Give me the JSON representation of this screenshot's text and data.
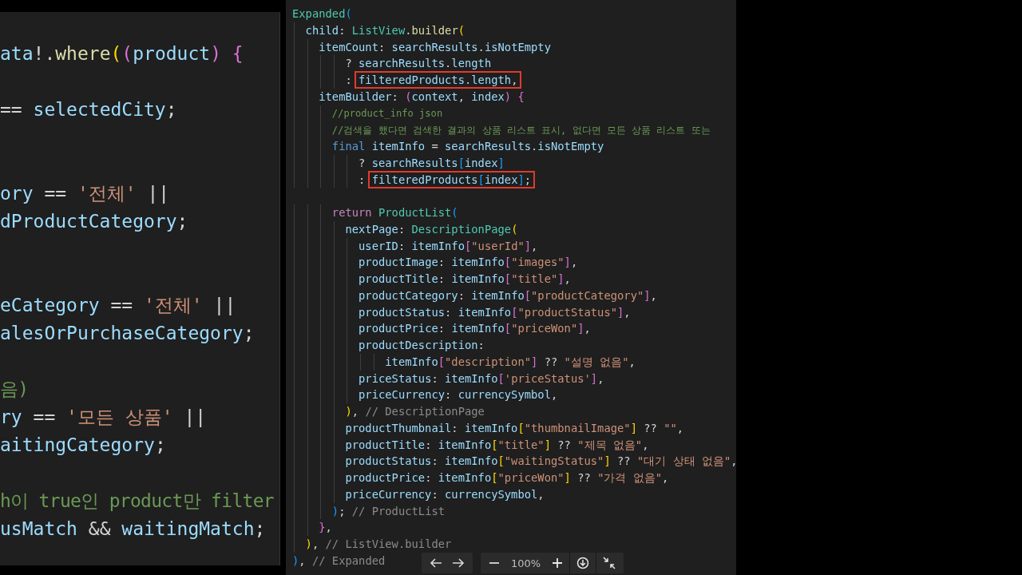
{
  "left_editor": {
    "blocks": [
      {
        "lines": [
          {
            "tokens": [
              {
                "kind": "v",
                "text": "ata"
              },
              {
                "kind": "p",
                "text": "!."
              },
              {
                "kind": "f",
                "text": "where"
              },
              {
                "kind": "b1",
                "text": "("
              },
              {
                "kind": "b2",
                "text": "("
              },
              {
                "kind": "v",
                "text": "product"
              },
              {
                "kind": "b2",
                "text": ") {"
              }
            ]
          }
        ]
      },
      {
        "lines": [
          {
            "tokens": [
              {
                "kind": "p",
                "text": "== "
              },
              {
                "kind": "v",
                "text": "selectedCity"
              },
              {
                "kind": "p",
                "text": ";"
              }
            ]
          }
        ]
      },
      {
        "lines": [
          {
            "tokens": [
              {
                "kind": "v",
                "text": "ory"
              },
              {
                "kind": "p",
                "text": " == "
              },
              {
                "kind": "s",
                "text": "'전체'"
              },
              {
                "kind": "p",
                "text": " ||"
              }
            ]
          },
          {
            "tokens": [
              {
                "kind": "v",
                "text": "dProductCategory"
              },
              {
                "kind": "p",
                "text": ";"
              }
            ]
          }
        ]
      },
      {
        "lines": [
          {
            "tokens": [
              {
                "kind": "v",
                "text": "eCategory"
              },
              {
                "kind": "p",
                "text": " == "
              },
              {
                "kind": "s",
                "text": "'전체'"
              },
              {
                "kind": "p",
                "text": " ||"
              }
            ]
          },
          {
            "tokens": [
              {
                "kind": "v",
                "text": "alesOrPurchaseCategory"
              },
              {
                "kind": "p",
                "text": ";"
              }
            ]
          }
        ]
      },
      {
        "lines": [
          {
            "tokens": [
              {
                "kind": "c",
                "text": "음)"
              }
            ]
          },
          {
            "tokens": [
              {
                "kind": "v",
                "text": "ry"
              },
              {
                "kind": "p",
                "text": " == "
              },
              {
                "kind": "s",
                "text": "'모든 상품'"
              },
              {
                "kind": "p",
                "text": " ||"
              }
            ]
          },
          {
            "tokens": [
              {
                "kind": "v",
                "text": "aitingCategory"
              },
              {
                "kind": "p",
                "text": ";"
              }
            ]
          }
        ]
      },
      {
        "lines": [
          {
            "tokens": [
              {
                "kind": "c",
                "text": "h이 true인 product만 filter"
              }
            ]
          },
          {
            "tokens": [
              {
                "kind": "v",
                "text": "usMatch"
              },
              {
                "kind": "p",
                "text": " && "
              },
              {
                "kind": "v",
                "text": "waitingMatch"
              },
              {
                "kind": "p",
                "text": ";"
              }
            ]
          }
        ]
      }
    ]
  },
  "right_editor": {
    "blocks": [
      {
        "lines": [
          {
            "tokens": [
              {
                "kind": "t",
                "text": "Expanded"
              },
              {
                "kind": "b3",
                "text": "("
              }
            ]
          },
          {
            "tokens": [
              {
                "kind": "v",
                "text": "  child"
              },
              {
                "kind": "p",
                "text": ": "
              },
              {
                "kind": "t",
                "text": "ListView"
              },
              {
                "kind": "p",
                "text": "."
              },
              {
                "kind": "f",
                "text": "builder"
              },
              {
                "kind": "b1",
                "text": "("
              }
            ]
          },
          {
            "tokens": [
              {
                "kind": "v",
                "text": "    itemCount"
              },
              {
                "kind": "p",
                "text": ": "
              },
              {
                "kind": "v",
                "text": "searchResults"
              },
              {
                "kind": "p",
                "text": "."
              },
              {
                "kind": "v",
                "text": "isNotEmpty"
              }
            ]
          },
          {
            "tokens": [
              {
                "kind": "p",
                "text": "        ? "
              },
              {
                "kind": "v",
                "text": "searchResults"
              },
              {
                "kind": "p",
                "text": "."
              },
              {
                "kind": "v",
                "text": "length"
              }
            ]
          },
          {
            "tokens": [
              {
                "kind": "p",
                "text": "        : "
              },
              {
                "kind": "box",
                "tokens": [
                  {
                    "kind": "v",
                    "text": "filteredProducts.length"
                  },
                  {
                    "kind": "p",
                    "text": ","
                  }
                ]
              }
            ]
          },
          {
            "tokens": [
              {
                "kind": "v",
                "text": "    itemBuilder"
              },
              {
                "kind": "p",
                "text": ": "
              },
              {
                "kind": "b2",
                "text": "("
              },
              {
                "kind": "v",
                "text": "context"
              },
              {
                "kind": "p",
                "text": ", "
              },
              {
                "kind": "v",
                "text": "index"
              },
              {
                "kind": "b2",
                "text": ") {"
              }
            ]
          },
          {
            "tokens": [
              {
                "kind": "c",
                "text": "      //product_info json"
              }
            ]
          },
          {
            "tokens": [
              {
                "kind": "c",
                "text": "      //검색을 했다면 검색한 결과의 상품 리스트 표시, 없다면 모든 상품 리스트 또는"
              }
            ]
          },
          {
            "tokens": [
              {
                "kind": "k",
                "text": "      final"
              },
              {
                "kind": "v",
                "text": " itemInfo"
              },
              {
                "kind": "p",
                "text": " = "
              },
              {
                "kind": "v",
                "text": "searchResults"
              },
              {
                "kind": "p",
                "text": "."
              },
              {
                "kind": "v",
                "text": "isNotEmpty"
              }
            ]
          },
          {
            "tokens": [
              {
                "kind": "p",
                "text": "          ? "
              },
              {
                "kind": "v",
                "text": "searchResults"
              },
              {
                "kind": "b3",
                "text": "["
              },
              {
                "kind": "v",
                "text": "index"
              },
              {
                "kind": "b3",
                "text": "]"
              }
            ]
          },
          {
            "tokens": [
              {
                "kind": "p",
                "text": "          : "
              },
              {
                "kind": "box",
                "tokens": [
                  {
                    "kind": "v",
                    "text": "filteredProducts"
                  },
                  {
                    "kind": "b3",
                    "text": "["
                  },
                  {
                    "kind": "v",
                    "text": "index"
                  },
                  {
                    "kind": "b3",
                    "text": "]"
                  },
                  {
                    "kind": "p",
                    "text": ";"
                  }
                ]
              }
            ]
          }
        ]
      },
      {
        "lines": [
          {
            "tokens": [
              {
                "kind": "r",
                "text": "      return "
              },
              {
                "kind": "t",
                "text": "ProductList"
              },
              {
                "kind": "b3",
                "text": "("
              }
            ]
          },
          {
            "tokens": [
              {
                "kind": "v",
                "text": "        nextPage"
              },
              {
                "kind": "p",
                "text": ": "
              },
              {
                "kind": "t",
                "text": "DescriptionPage"
              },
              {
                "kind": "b1",
                "text": "("
              }
            ]
          },
          {
            "tokens": [
              {
                "kind": "v",
                "text": "          userID"
              },
              {
                "kind": "p",
                "text": ": "
              },
              {
                "kind": "v",
                "text": "itemInfo"
              },
              {
                "kind": "b2",
                "text": "["
              },
              {
                "kind": "s",
                "text": "\"userId\""
              },
              {
                "kind": "b2",
                "text": "]"
              },
              {
                "kind": "p",
                "text": ","
              }
            ]
          },
          {
            "tokens": [
              {
                "kind": "v",
                "text": "          productImage"
              },
              {
                "kind": "p",
                "text": ": "
              },
              {
                "kind": "v",
                "text": "itemInfo"
              },
              {
                "kind": "b2",
                "text": "["
              },
              {
                "kind": "s",
                "text": "\"images\""
              },
              {
                "kind": "b2",
                "text": "]"
              },
              {
                "kind": "p",
                "text": ","
              }
            ]
          },
          {
            "tokens": [
              {
                "kind": "v",
                "text": "          productTitle"
              },
              {
                "kind": "p",
                "text": ": "
              },
              {
                "kind": "v",
                "text": "itemInfo"
              },
              {
                "kind": "b2",
                "text": "["
              },
              {
                "kind": "s",
                "text": "\"title\""
              },
              {
                "kind": "b2",
                "text": "]"
              },
              {
                "kind": "p",
                "text": ","
              }
            ]
          },
          {
            "tokens": [
              {
                "kind": "v",
                "text": "          productCategory"
              },
              {
                "kind": "p",
                "text": ": "
              },
              {
                "kind": "v",
                "text": "itemInfo"
              },
              {
                "kind": "b2",
                "text": "["
              },
              {
                "kind": "s",
                "text": "\"productCategory\""
              },
              {
                "kind": "b2",
                "text": "]"
              },
              {
                "kind": "p",
                "text": ","
              }
            ]
          },
          {
            "tokens": [
              {
                "kind": "v",
                "text": "          productStatus"
              },
              {
                "kind": "p",
                "text": ": "
              },
              {
                "kind": "v",
                "text": "itemInfo"
              },
              {
                "kind": "b2",
                "text": "["
              },
              {
                "kind": "s",
                "text": "\"productStatus\""
              },
              {
                "kind": "b2",
                "text": "]"
              },
              {
                "kind": "p",
                "text": ","
              }
            ]
          },
          {
            "tokens": [
              {
                "kind": "v",
                "text": "          productPrice"
              },
              {
                "kind": "p",
                "text": ": "
              },
              {
                "kind": "v",
                "text": "itemInfo"
              },
              {
                "kind": "b2",
                "text": "["
              },
              {
                "kind": "s",
                "text": "\"priceWon\""
              },
              {
                "kind": "b2",
                "text": "]"
              },
              {
                "kind": "p",
                "text": ","
              }
            ]
          },
          {
            "tokens": [
              {
                "kind": "v",
                "text": "          productDescription"
              },
              {
                "kind": "p",
                "text": ":"
              }
            ]
          },
          {
            "tokens": [
              {
                "kind": "v",
                "text": "              itemInfo"
              },
              {
                "kind": "b2",
                "text": "["
              },
              {
                "kind": "s",
                "text": "\"description\""
              },
              {
                "kind": "b2",
                "text": "]"
              },
              {
                "kind": "p",
                "text": " ?? "
              },
              {
                "kind": "s",
                "text": "\"설명 없음\""
              },
              {
                "kind": "p",
                "text": ","
              }
            ]
          },
          {
            "tokens": [
              {
                "kind": "v",
                "text": "          priceStatus"
              },
              {
                "kind": "p",
                "text": ": "
              },
              {
                "kind": "v",
                "text": "itemInfo"
              },
              {
                "kind": "b2",
                "text": "["
              },
              {
                "kind": "s",
                "text": "'priceStatus'"
              },
              {
                "kind": "b2",
                "text": "]"
              },
              {
                "kind": "p",
                "text": ","
              }
            ]
          },
          {
            "tokens": [
              {
                "kind": "v",
                "text": "          priceCurrency"
              },
              {
                "kind": "p",
                "text": ": "
              },
              {
                "kind": "v",
                "text": "currencySymbol"
              },
              {
                "kind": "p",
                "text": ","
              }
            ]
          },
          {
            "tokens": [
              {
                "kind": "b1",
                "text": "        )"
              },
              {
                "kind": "p",
                "text": ", "
              },
              {
                "kind": "l",
                "text": "// DescriptionPage"
              }
            ]
          },
          {
            "tokens": [
              {
                "kind": "v",
                "text": "        productThumbnail"
              },
              {
                "kind": "p",
                "text": ": "
              },
              {
                "kind": "v",
                "text": "itemInfo"
              },
              {
                "kind": "b1",
                "text": "["
              },
              {
                "kind": "s",
                "text": "\"thumbnailImage\""
              },
              {
                "kind": "b1",
                "text": "]"
              },
              {
                "kind": "p",
                "text": " ?? "
              },
              {
                "kind": "s",
                "text": "\"\""
              },
              {
                "kind": "p",
                "text": ","
              }
            ]
          },
          {
            "tokens": [
              {
                "kind": "v",
                "text": "        productTitle"
              },
              {
                "kind": "p",
                "text": ": "
              },
              {
                "kind": "v",
                "text": "itemInfo"
              },
              {
                "kind": "b1",
                "text": "["
              },
              {
                "kind": "s",
                "text": "\"title\""
              },
              {
                "kind": "b1",
                "text": "]"
              },
              {
                "kind": "p",
                "text": " ?? "
              },
              {
                "kind": "s",
                "text": "\"제목 없음\""
              },
              {
                "kind": "p",
                "text": ","
              }
            ]
          },
          {
            "tokens": [
              {
                "kind": "v",
                "text": "        productStatus"
              },
              {
                "kind": "p",
                "text": ": "
              },
              {
                "kind": "v",
                "text": "itemInfo"
              },
              {
                "kind": "b1",
                "text": "["
              },
              {
                "kind": "s",
                "text": "\"waitingStatus\""
              },
              {
                "kind": "b1",
                "text": "]"
              },
              {
                "kind": "p",
                "text": " ?? "
              },
              {
                "kind": "s",
                "text": "\"대기 상태 없음\""
              },
              {
                "kind": "p",
                "text": ","
              }
            ]
          },
          {
            "tokens": [
              {
                "kind": "v",
                "text": "        productPrice"
              },
              {
                "kind": "p",
                "text": ": "
              },
              {
                "kind": "v",
                "text": "itemInfo"
              },
              {
                "kind": "b1",
                "text": "["
              },
              {
                "kind": "s",
                "text": "\"priceWon\""
              },
              {
                "kind": "b1",
                "text": "]"
              },
              {
                "kind": "p",
                "text": " ?? "
              },
              {
                "kind": "s",
                "text": "\"가격 없음\""
              },
              {
                "kind": "p",
                "text": ","
              }
            ]
          },
          {
            "tokens": [
              {
                "kind": "v",
                "text": "        priceCurrency"
              },
              {
                "kind": "p",
                "text": ": "
              },
              {
                "kind": "v",
                "text": "currencySymbol"
              },
              {
                "kind": "p",
                "text": ","
              }
            ]
          },
          {
            "tokens": [
              {
                "kind": "b3",
                "text": "      )"
              },
              {
                "kind": "p",
                "text": "; "
              },
              {
                "kind": "l",
                "text": "// ProductList"
              }
            ]
          },
          {
            "tokens": [
              {
                "kind": "b2",
                "text": "    }"
              },
              {
                "kind": "p",
                "text": ","
              }
            ]
          },
          {
            "tokens": [
              {
                "kind": "b1",
                "text": "  )"
              },
              {
                "kind": "p",
                "text": ", "
              },
              {
                "kind": "l",
                "text": "// ListView.builder"
              }
            ]
          },
          {
            "tokens": [
              {
                "kind": "b3",
                "text": ")"
              },
              {
                "kind": "p",
                "text": ", "
              },
              {
                "kind": "l",
                "text": "// Expanded"
              }
            ]
          }
        ]
      }
    ]
  },
  "viewer_toolbar": {
    "zoom": "100%"
  }
}
